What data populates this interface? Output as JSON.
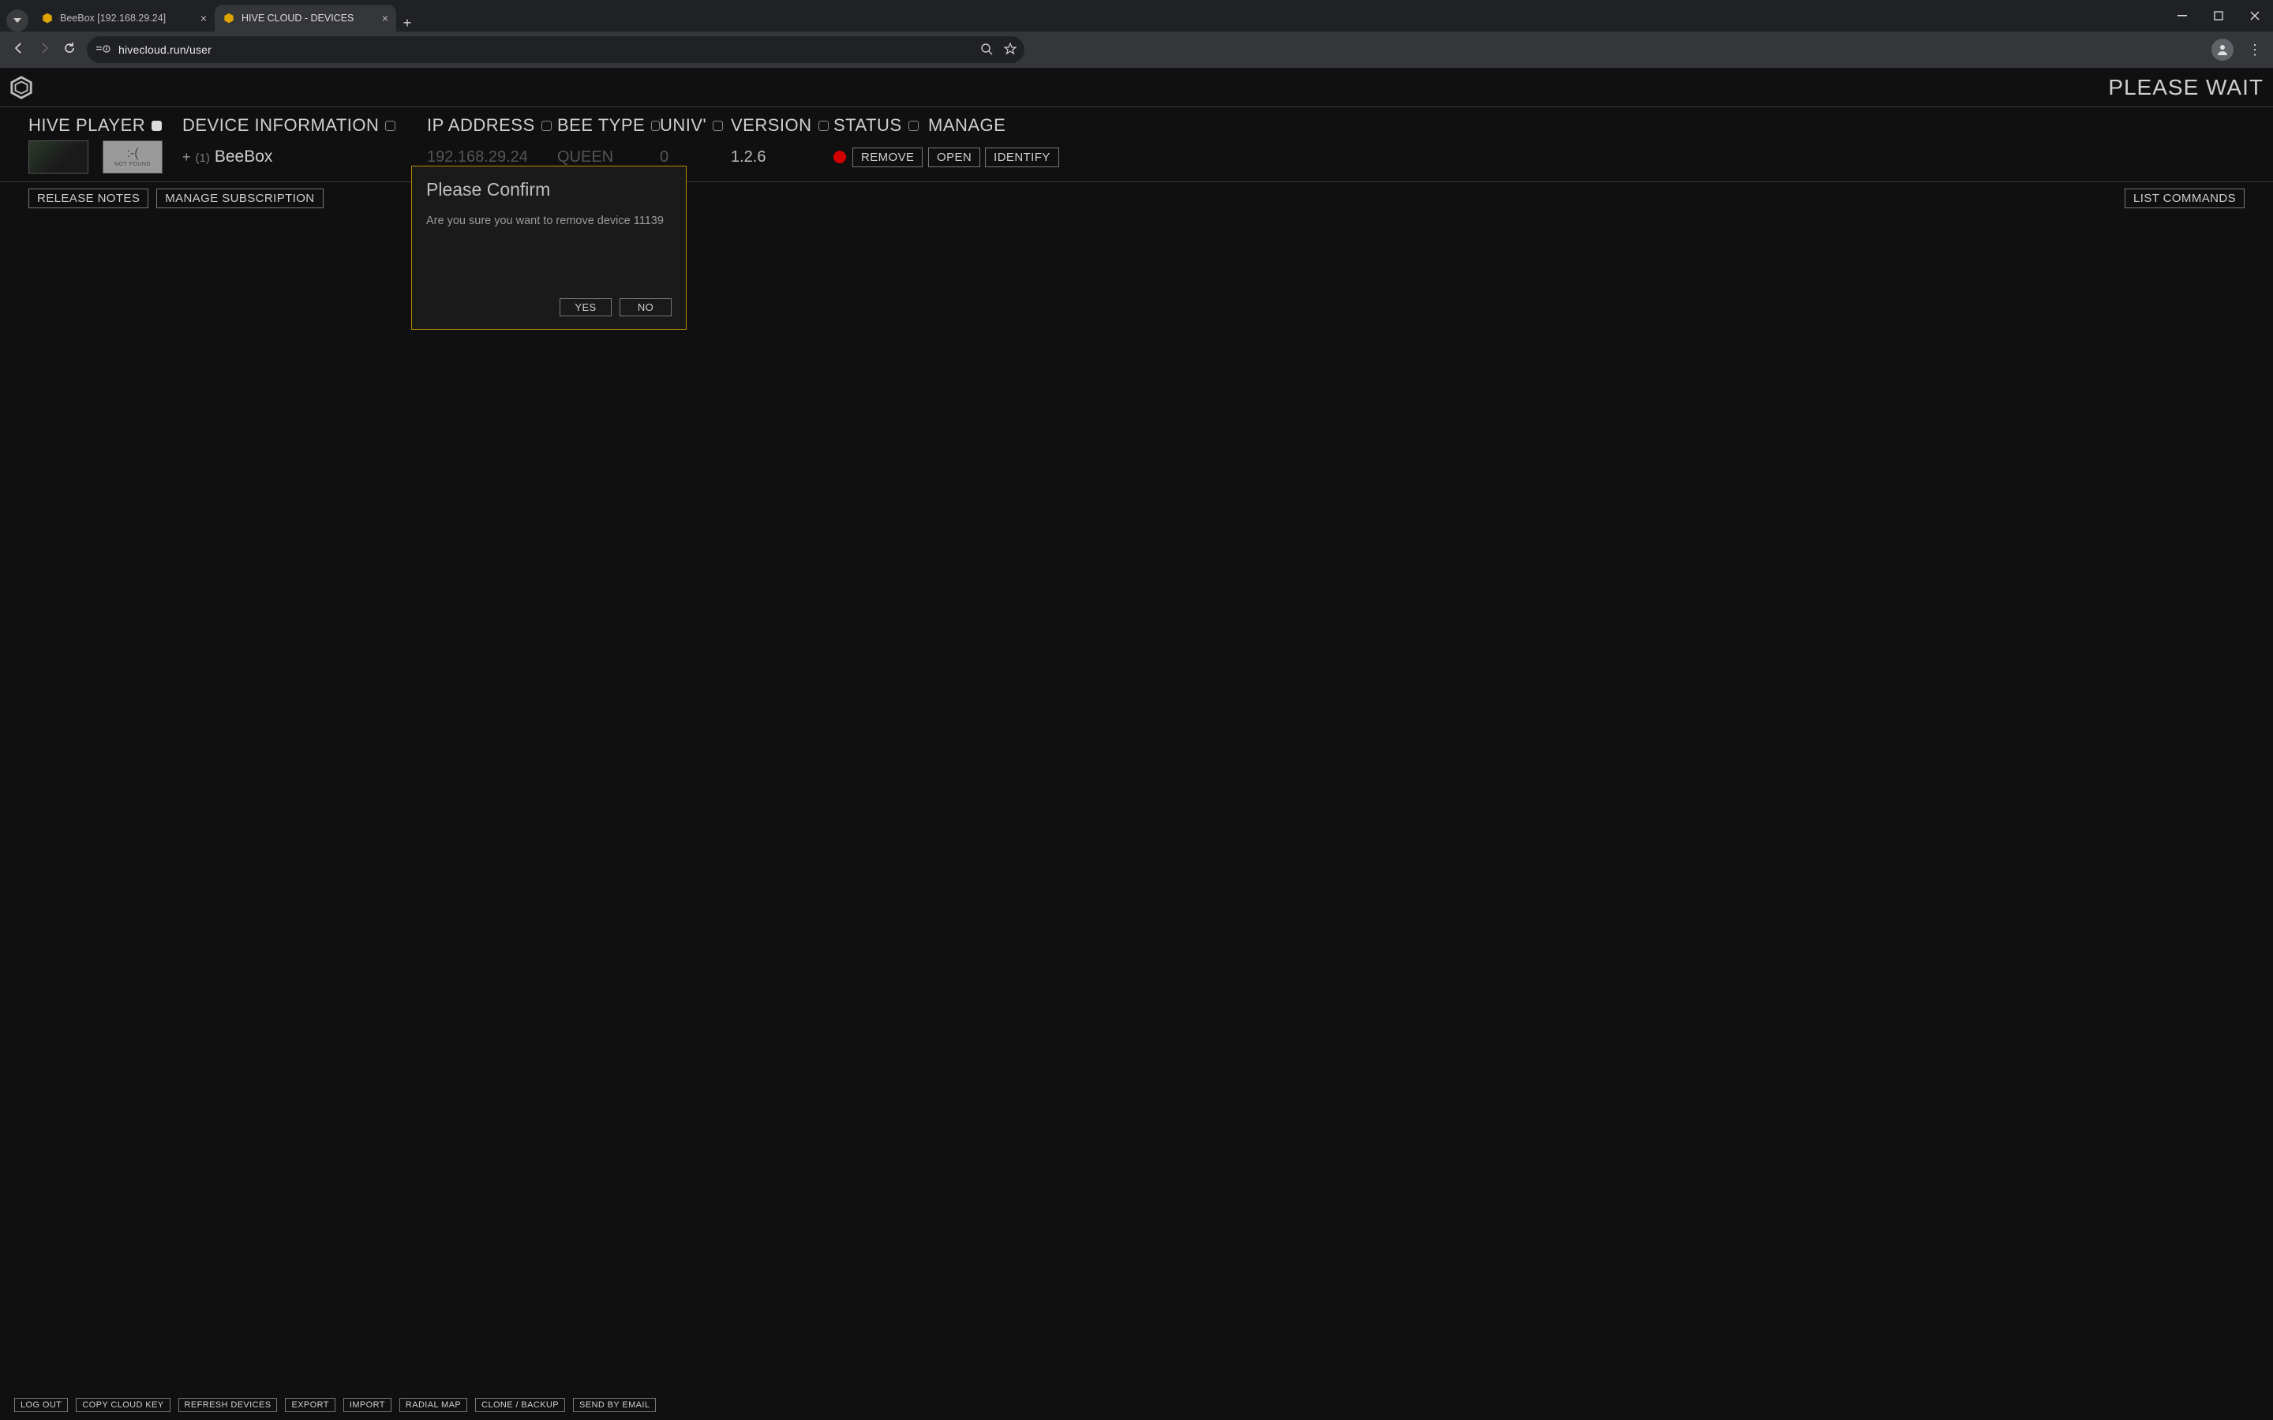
{
  "browser": {
    "tabs": [
      {
        "title": "BeeBox [192.168.29.24]",
        "active": false
      },
      {
        "title": "HIVE CLOUD - DEVICES",
        "active": true
      }
    ],
    "url": "hivecloud.run/user"
  },
  "header": {
    "status": "PLEASE WAIT"
  },
  "columns": {
    "player": "HIVE PLAYER",
    "device_info": "DEVICE INFORMATION",
    "ip": "IP ADDRESS",
    "bee_type": "BEE TYPE",
    "univ": "UNIV'",
    "version": "VERSION",
    "status": "STATUS",
    "manage": "MANAGE"
  },
  "device": {
    "expand": "+",
    "count": "(1)",
    "name": "BeeBox",
    "ip": "192.168.29.24",
    "bee_type": "QUEEN",
    "univ": "0",
    "version": "1.2.6",
    "status_color": "#d40000",
    "thumb2_label": "NOT FOUND"
  },
  "buttons": {
    "remove": "REMOVE",
    "open": "OPEN",
    "identify": "IDENTIFY",
    "release_notes": "RELEASE NOTES",
    "manage_subscription": "MANAGE SUBSCRIPTION",
    "list_commands": "LIST COMMANDS"
  },
  "footer": {
    "log_out": "LOG OUT",
    "copy_cloud_key": "COPY CLOUD KEY",
    "refresh_devices": "REFRESH DEVICES",
    "export": "EXPORT",
    "import": "IMPORT",
    "radial_map": "RADIAL MAP",
    "clone_backup": "CLONE / BACKUP",
    "send_by_email": "SEND BY EMAIL"
  },
  "modal": {
    "title": "Please Confirm",
    "message": "Are you sure you want to remove device 11139",
    "yes": "YES",
    "no": "NO"
  }
}
